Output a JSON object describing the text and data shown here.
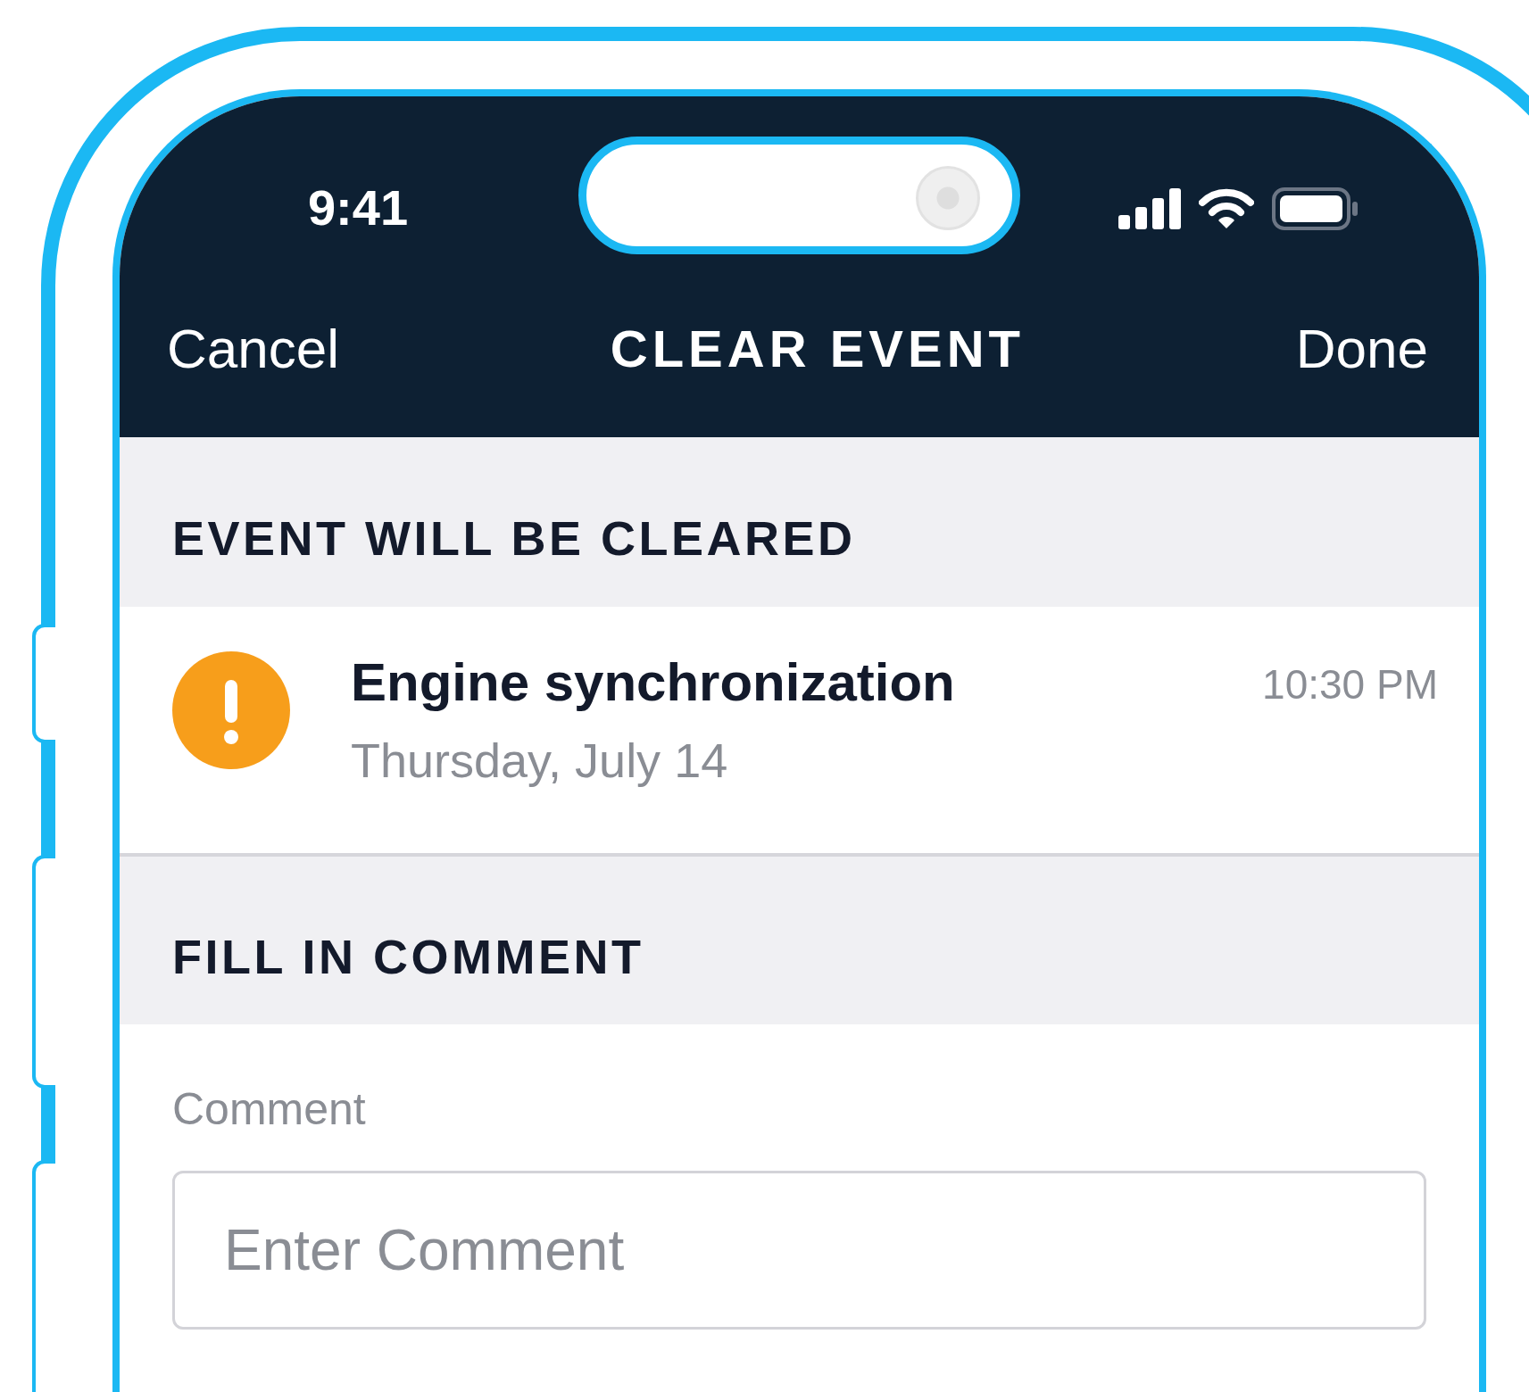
{
  "status_bar": {
    "time": "9:41"
  },
  "nav": {
    "cancel": "Cancel",
    "title": "CLEAR EVENT",
    "done": "Done"
  },
  "event_section": {
    "header": "EVENT WILL BE CLEARED",
    "event": {
      "kind": "warning",
      "title": "Engine synchronization",
      "date": "Thursday, July 14",
      "time": "10:30 PM"
    }
  },
  "comment_section": {
    "header": "FILL IN COMMENT",
    "label": "Comment",
    "placeholder": "Enter Comment"
  }
}
